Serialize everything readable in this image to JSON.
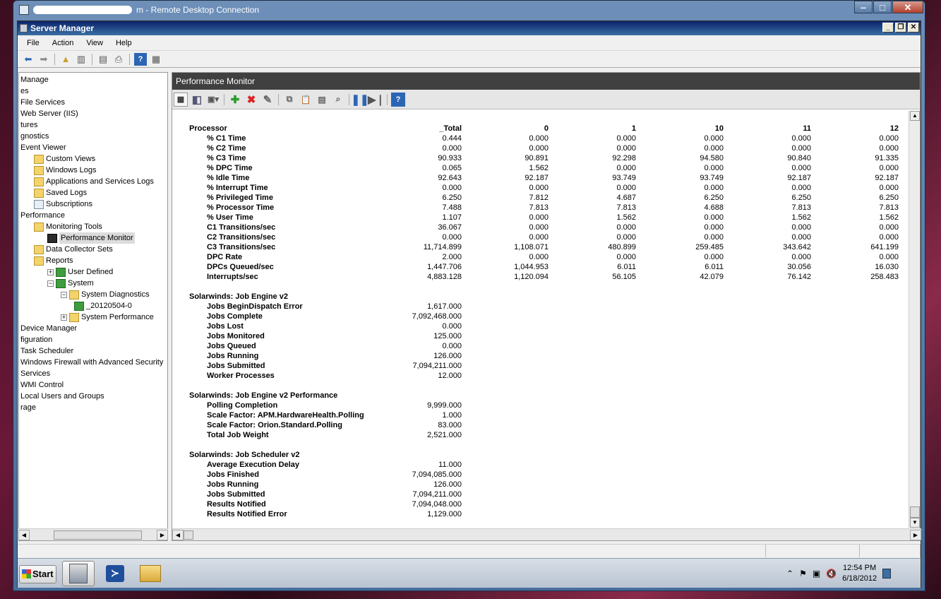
{
  "rdc": {
    "title_suffix": "m - Remote Desktop Connection",
    "buttons": [
      "‒",
      "□",
      "✕"
    ]
  },
  "window": {
    "title": "Server Manager"
  },
  "menu": [
    "File",
    "Action",
    "View",
    "Help"
  ],
  "tree": {
    "items": [
      {
        "label": "Manage",
        "icon": "server-icon",
        "indent": 0,
        "redacted": true
      },
      {
        "label": "es",
        "icon": "",
        "indent": 0
      },
      {
        "label": "File Services",
        "icon": "",
        "indent": 0
      },
      {
        "label": "Web Server (IIS)",
        "icon": "",
        "indent": 0
      },
      {
        "label": "tures",
        "icon": "",
        "indent": 0
      },
      {
        "label": "gnostics",
        "icon": "",
        "indent": 0
      },
      {
        "label": "Event Viewer",
        "icon": "",
        "indent": 0
      },
      {
        "label": "Custom Views",
        "icon": "folder",
        "indent": 1
      },
      {
        "label": "Windows Logs",
        "icon": "folder",
        "indent": 1
      },
      {
        "label": "Applications and Services Logs",
        "icon": "folder",
        "indent": 1
      },
      {
        "label": "Saved Logs",
        "icon": "folder",
        "indent": 1
      },
      {
        "label": "Subscriptions",
        "icon": "doc",
        "indent": 1
      },
      {
        "label": "Performance",
        "icon": "",
        "indent": 0
      },
      {
        "label": "Monitoring Tools",
        "icon": "folder",
        "indent": 1
      },
      {
        "label": "Performance Monitor",
        "icon": "pm",
        "indent": 2,
        "selected": true
      },
      {
        "label": "Data Collector Sets",
        "icon": "folder",
        "indent": 1
      },
      {
        "label": "Reports",
        "icon": "folder",
        "indent": 1
      },
      {
        "label": "User Defined",
        "icon": "green",
        "indent": 2,
        "expander": "+"
      },
      {
        "label": "System",
        "icon": "green",
        "indent": 2,
        "expander": "−"
      },
      {
        "label": "System Diagnostics",
        "icon": "folder",
        "indent": 3,
        "expander": "−"
      },
      {
        "label": "_20120504-0",
        "icon": "green",
        "indent": 4
      },
      {
        "label": "System Performance",
        "icon": "folder",
        "indent": 3,
        "expander": "+"
      },
      {
        "label": "Device Manager",
        "icon": "",
        "indent": 0
      },
      {
        "label": "figuration",
        "icon": "",
        "indent": 0
      },
      {
        "label": "Task Scheduler",
        "icon": "",
        "indent": 0
      },
      {
        "label": "Windows Firewall with Advanced Security",
        "icon": "",
        "indent": 0
      },
      {
        "label": "Services",
        "icon": "",
        "indent": 0
      },
      {
        "label": "WMI Control",
        "icon": "",
        "indent": 0
      },
      {
        "label": "Local Users and Groups",
        "icon": "",
        "indent": 0
      },
      {
        "label": "rage",
        "icon": "",
        "indent": 0
      }
    ]
  },
  "perfmon": {
    "title": "Performance Monitor",
    "columns": [
      "_Total",
      "0",
      "1",
      "10",
      "11",
      "12"
    ],
    "sections": [
      {
        "name": "Processor",
        "rows": [
          {
            "label": "% C1 Time",
            "values": [
              "0.444",
              "0.000",
              "0.000",
              "0.000",
              "0.000",
              "0.000"
            ]
          },
          {
            "label": "% C2 Time",
            "values": [
              "0.000",
              "0.000",
              "0.000",
              "0.000",
              "0.000",
              "0.000"
            ]
          },
          {
            "label": "% C3 Time",
            "values": [
              "90.933",
              "90.891",
              "92.298",
              "94.580",
              "90.840",
              "91.335"
            ]
          },
          {
            "label": "% DPC Time",
            "values": [
              "0.065",
              "1.562",
              "0.000",
              "0.000",
              "0.000",
              "0.000"
            ]
          },
          {
            "label": "% Idle Time",
            "values": [
              "92.643",
              "92.187",
              "93.749",
              "93.749",
              "92.187",
              "92.187"
            ]
          },
          {
            "label": "% Interrupt Time",
            "values": [
              "0.000",
              "0.000",
              "0.000",
              "0.000",
              "0.000",
              "0.000"
            ]
          },
          {
            "label": "% Privileged Time",
            "values": [
              "6.250",
              "7.812",
              "4.687",
              "6.250",
              "6.250",
              "6.250"
            ]
          },
          {
            "label": "% Processor Time",
            "values": [
              "7.488",
              "7.813",
              "7.813",
              "4.688",
              "7.813",
              "7.813"
            ]
          },
          {
            "label": "% User Time",
            "values": [
              "1.107",
              "0.000",
              "1.562",
              "0.000",
              "1.562",
              "1.562"
            ]
          },
          {
            "label": "C1 Transitions/sec",
            "values": [
              "36.067",
              "0.000",
              "0.000",
              "0.000",
              "0.000",
              "0.000"
            ]
          },
          {
            "label": "C2 Transitions/sec",
            "values": [
              "0.000",
              "0.000",
              "0.000",
              "0.000",
              "0.000",
              "0.000"
            ]
          },
          {
            "label": "C3 Transitions/sec",
            "values": [
              "11,714.899",
              "1,108.071",
              "480.899",
              "259.485",
              "343.642",
              "641.199"
            ]
          },
          {
            "label": "DPC Rate",
            "values": [
              "2.000",
              "0.000",
              "0.000",
              "0.000",
              "0.000",
              "0.000"
            ]
          },
          {
            "label": "DPCs Queued/sec",
            "values": [
              "1,447.706",
              "1,044.953",
              "6.011",
              "6.011",
              "30.056",
              "16.030"
            ]
          },
          {
            "label": "Interrupts/sec",
            "values": [
              "4,883.128",
              "1,120.094",
              "56.105",
              "42.079",
              "76.142",
              "258.483"
            ]
          }
        ]
      },
      {
        "name": "Solarwinds: Job Engine v2",
        "rows": [
          {
            "label": "Jobs BeginDispatch Error",
            "values": [
              "1,617.000"
            ]
          },
          {
            "label": "Jobs Complete",
            "values": [
              "7,092,468.000"
            ]
          },
          {
            "label": "Jobs Lost",
            "values": [
              "0.000"
            ]
          },
          {
            "label": "Jobs Monitored",
            "values": [
              "125.000"
            ]
          },
          {
            "label": "Jobs Queued",
            "values": [
              "0.000"
            ]
          },
          {
            "label": "Jobs Running",
            "values": [
              "126.000"
            ]
          },
          {
            "label": "Jobs Submitted",
            "values": [
              "7,094,211.000"
            ]
          },
          {
            "label": "Worker Processes",
            "values": [
              "12.000"
            ]
          }
        ]
      },
      {
        "name": "Solarwinds: Job Engine v2 Performance",
        "rows": [
          {
            "label": "Polling Completion",
            "values": [
              "9,999.000"
            ]
          },
          {
            "label": "Scale Factor: APM.HardwareHealth.Polling",
            "values": [
              "1.000"
            ]
          },
          {
            "label": "Scale Factor: Orion.Standard.Polling",
            "values": [
              "83.000"
            ]
          },
          {
            "label": "Total Job Weight",
            "values": [
              "2,521.000"
            ]
          }
        ]
      },
      {
        "name": "Solarwinds: Job Scheduler v2",
        "rows": [
          {
            "label": "Average Execution Delay",
            "values": [
              "11.000"
            ]
          },
          {
            "label": "Jobs Finished",
            "values": [
              "7,094,085.000"
            ]
          },
          {
            "label": "Jobs Running",
            "values": [
              "126.000"
            ]
          },
          {
            "label": "Jobs Submitted",
            "values": [
              "7,094,211.000"
            ]
          },
          {
            "label": "Results Notified",
            "values": [
              "7,094,048.000"
            ]
          },
          {
            "label": "Results Notified Error",
            "values": [
              "1,129.000"
            ]
          }
        ]
      }
    ]
  },
  "taskbar": {
    "start": "Start",
    "time": "12:54 PM",
    "date": "6/18/2012"
  }
}
